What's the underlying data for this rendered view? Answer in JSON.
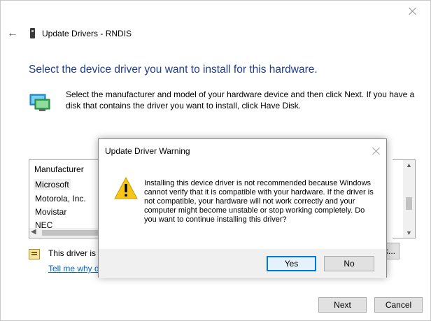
{
  "window": {
    "title": "Update Drivers - RNDIS",
    "heading": "Select the device driver you want to install for this hardware.",
    "description": "Select the manufacturer and model of your hardware device and then click Next. If you have a disk that contains the driver you want to install, click Have Disk."
  },
  "manufacturer_list": {
    "header": "Manufacturer",
    "items": [
      "Microsoft",
      "Motorola, Inc.",
      "Movistar",
      "NEC"
    ],
    "selected": "Microsoft"
  },
  "signed": {
    "text": "This driver is d",
    "link": "Tell me why d"
  },
  "have_disk_label": "k...",
  "buttons": {
    "next": "Next",
    "cancel": "Cancel"
  },
  "dialog": {
    "title": "Update Driver Warning",
    "message": "Installing this device driver is not recommended because Windows cannot verify that it is compatible with your hardware.  If the driver is not compatible, your hardware will not work correctly and your computer might become unstable or stop working completely.  Do you want to continue installing this driver?",
    "yes": "Yes",
    "no": "No"
  },
  "icons": {
    "back": "back-arrow-icon",
    "device": "device-icon",
    "network": "network-adapter-icon",
    "warning": "warning-icon",
    "signed": "certificate-icon"
  }
}
